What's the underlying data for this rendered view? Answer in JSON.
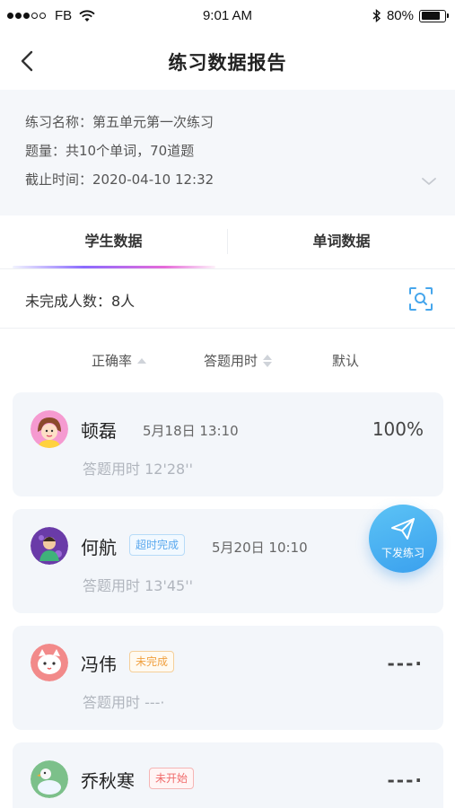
{
  "status_bar": {
    "carrier": "FB",
    "time": "9:01 AM",
    "battery": "80%",
    "battery_level": 0.8
  },
  "nav": {
    "title": "练习数据报告"
  },
  "info": {
    "name_label": "练习名称：",
    "name_value": "第五单元第一次练习",
    "count_label": "题量：",
    "count_value": "共10个单词，70道题",
    "deadline_label": "截止时间：",
    "deadline_value": "2020-04-10 12:32"
  },
  "tabs": [
    {
      "label": "学生数据",
      "active": true
    },
    {
      "label": "单词数据",
      "active": false
    }
  ],
  "incomplete": {
    "text": "未完成人数：8人"
  },
  "sort": {
    "accuracy": "正确率",
    "duration": "答题用时",
    "default": "默认"
  },
  "students": [
    {
      "name": "顿磊",
      "date": "5月18日 13:10",
      "score": "100%",
      "duration": "答题用时 12'28''",
      "badge": ""
    },
    {
      "name": "何航",
      "date": "5月20日 10:10",
      "score": "",
      "duration": "答题用时 13'45''",
      "badge": "超时完成"
    },
    {
      "name": "冯伟",
      "date": "",
      "score": "---·",
      "duration": "答题用时 ---·",
      "badge": "未完成"
    },
    {
      "name": "乔秋寒",
      "date": "",
      "score": "---·",
      "duration": "",
      "badge": "未开始"
    }
  ],
  "fab": {
    "label": "下发练习"
  },
  "colors": {
    "accent_blue": "#3aa0ee",
    "badge_overtime": "#5aa8ee",
    "badge_incomplete": "#f0a040",
    "badge_notstarted": "#f06b6b",
    "card_bg": "#f3f6fa"
  },
  "icons": [
    "back-arrow-icon",
    "chevron-down-icon",
    "scan-icon",
    "paper-plane-icon",
    "wifi-icon",
    "bluetooth-icon",
    "battery-icon"
  ]
}
